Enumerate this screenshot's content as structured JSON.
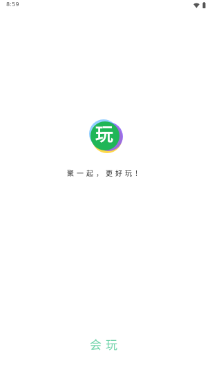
{
  "status_bar": {
    "time": "8:59",
    "icons": [
      "wifi-icon",
      "battery-icon"
    ]
  },
  "splash": {
    "logo_char": "玩",
    "slogan": "聚一起，更好玩！",
    "brand_name": "会玩",
    "colors": {
      "logo_green": "#20b657",
      "logo_yellow": "#ffd84a",
      "logo_purple": "#8b5cf6",
      "logo_blue": "#3aa5ff",
      "brand_text": "#6fd3a9"
    }
  }
}
